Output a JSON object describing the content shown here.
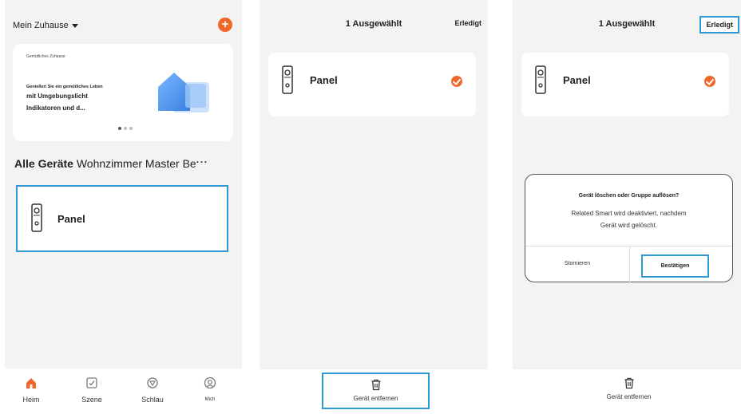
{
  "screen1": {
    "home_title": "Mein Zuhause",
    "add_label": "+",
    "banner": {
      "small_text": "Gemütliches Zuhause",
      "line1": "Genießen Sie ein gemütliches Leben",
      "line2": "mit Umgebungslicht",
      "line3": "Indikatoren und d..."
    },
    "rooms": {
      "all_devices": "Alle Geräte",
      "others": "Wohnzimmer Master Be",
      "more": "···"
    },
    "device": {
      "name": "Panel",
      "icon": "panel-device-icon"
    },
    "tabs": [
      {
        "label": "Heim",
        "icon": "home-icon",
        "active": true
      },
      {
        "label": "Szene",
        "icon": "scene-icon",
        "active": false
      },
      {
        "label": "Schlau",
        "icon": "smart-icon",
        "active": false
      },
      {
        "label": "Mich",
        "icon": "profile-icon",
        "active": false
      }
    ]
  },
  "screen2": {
    "title": "1 Ausgewählt",
    "done_label": "Erledigt",
    "device": {
      "name": "Panel",
      "selected": true
    },
    "remove_label": "Gerät entfernen"
  },
  "screen3": {
    "title": "1 Ausgewählt",
    "done_label": "Erledigt",
    "device": {
      "name": "Panel",
      "selected": true
    },
    "remove_label": "Gerät entfernen",
    "dialog": {
      "title": "Gerät löschen oder Gruppe auflösen?",
      "message_line1": "Related Smart wird deaktiviert, nachdem",
      "message_line2": "Gerät wird gelöscht.",
      "cancel_label": "Stornieren",
      "confirm_label": "Bestätigen"
    }
  },
  "colors": {
    "accent": "#f0672b",
    "highlight": "#2f97d6",
    "background": "#f3f3f3"
  }
}
